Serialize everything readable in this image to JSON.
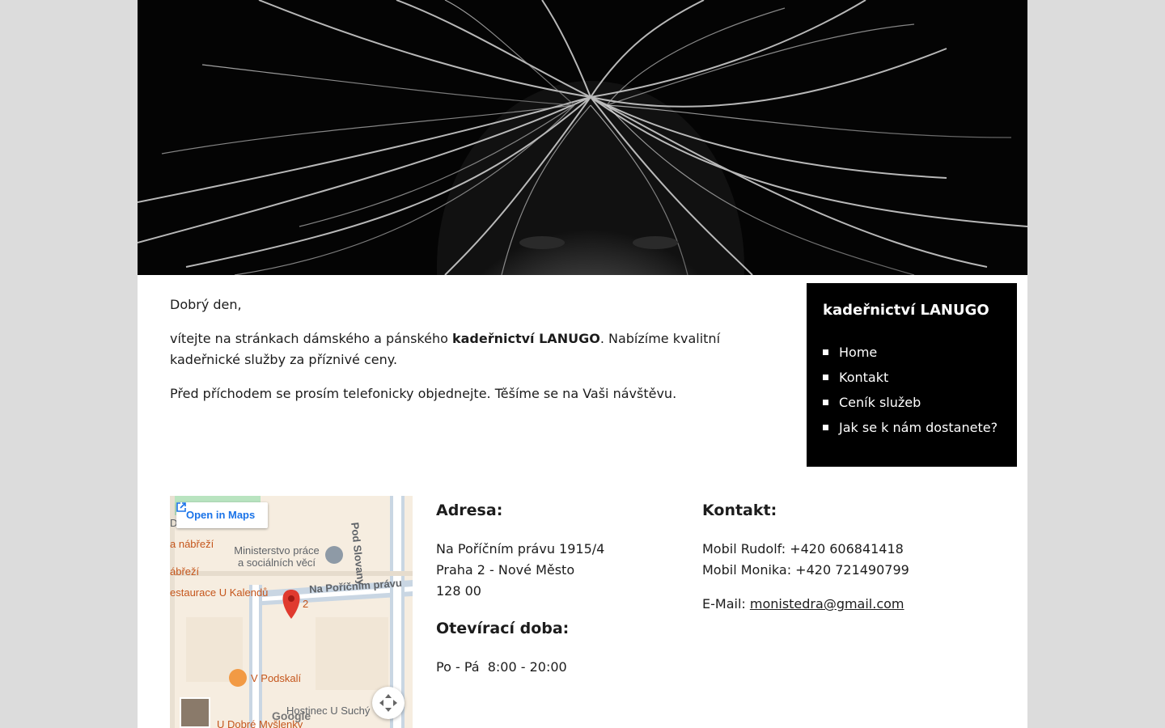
{
  "intro": {
    "greeting": "Dobrý den,",
    "welcome_before": "vítejte na stránkach dámského a pánského ",
    "welcome_bold": "kadeřnictví LANUGO",
    "welcome_after": ". Nabízíme kvalitní kadeřnické služby za příznivé ceny.",
    "note": "Před příchodem se prosím telefonicky objednejte. Těšíme se na Vaši návštěvu."
  },
  "sidebar": {
    "title": "kadeřnictví LANUGO",
    "items": [
      {
        "label": "Home"
      },
      {
        "label": "Kontakt"
      },
      {
        "label": "Ceník služeb"
      },
      {
        "label": "Jak se k nám dostanete?"
      }
    ]
  },
  "map": {
    "open_label": "Open in Maps",
    "labels": {
      "nabrezi1": "a nábřeží",
      "ministry": "Ministerstvo práce\na sociálních věcí",
      "nabrezi2": "ábřeží",
      "restaurant": "estaurace U Kalendů",
      "street_main": "Na Poříčním právu",
      "street_side": "Pod Slovany",
      "podskali": "V Podskalí",
      "hostinec": "Hostinec U Suchý",
      "dobre": "U Dobré Myšlenky",
      "marker_num": "2",
      "d_letter": "D",
      "google": "Google"
    }
  },
  "address": {
    "heading": "Adresa:",
    "line1": "Na Poříčním právu 1915/4",
    "line2": "Praha 2 - Nové Město",
    "line3": "128 00",
    "hours_heading": "Otevírací doba:",
    "hours": "Po - Pá  8:00 - 20:00"
  },
  "contact": {
    "heading": "Kontakt:",
    "mobile1": "Mobil Rudolf: +420 606841418",
    "mobile2": "Mobil Monika: +420 721490799",
    "email_label": "E-Mail: ",
    "email": "monistedra@gmail.com"
  }
}
